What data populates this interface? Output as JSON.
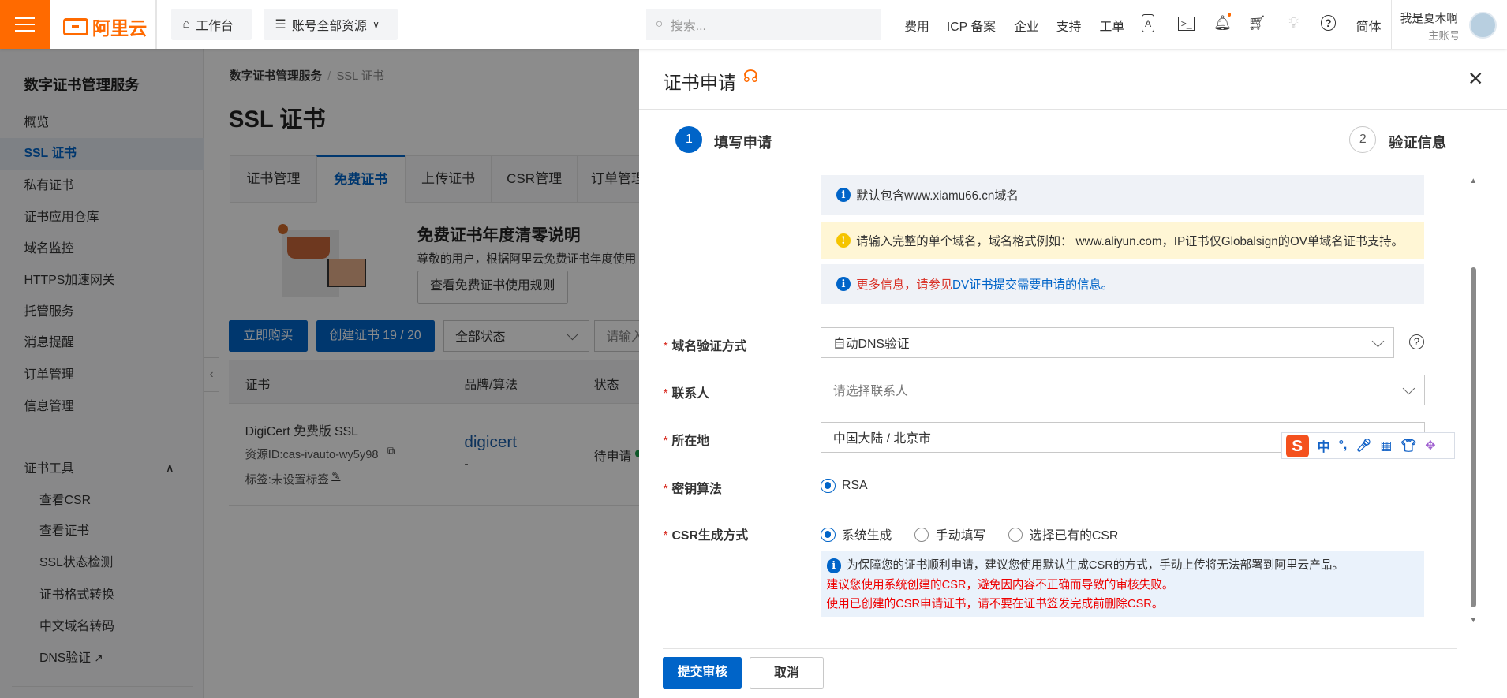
{
  "topbar": {
    "logo": "阿里云",
    "workbench": "工作台",
    "resources": "账号全部资源",
    "search_placeholder": "搜索...",
    "nav": [
      "费用",
      "ICP 备案",
      "企业",
      "支持",
      "工单"
    ],
    "icons": [
      "app-icon",
      "terminal-icon",
      "bell-icon",
      "cart-icon",
      "lightbulb-icon",
      "help-icon"
    ],
    "lang": "简体",
    "user_name": "我是夏木啊",
    "user_role": "主账号"
  },
  "sidebar": {
    "title": "数字证书管理服务",
    "items": [
      "概览",
      "SSL 证书",
      "私有证书",
      "证书应用仓库",
      "域名监控",
      "HTTPS加速网关",
      "托管服务",
      "消息提醒",
      "订单管理",
      "信息管理"
    ],
    "active": "SSL 证书",
    "tools_title": "证书工具",
    "tools": [
      "查看CSR",
      "查看证书",
      "SSL状态检测",
      "证书格式转换",
      "中文域名转码",
      "DNS验证"
    ]
  },
  "main": {
    "breadcrumb": [
      "数字证书管理服务",
      "SSL 证书"
    ],
    "title": "SSL 证书",
    "tabs": [
      "证书管理",
      "免费证书",
      "上传证书",
      "CSR管理",
      "订单管理"
    ],
    "active_tab": "免费证书",
    "banner": {
      "title": "免费证书年度清零说明",
      "text": "尊敬的用户，根据阿里云免费证书年度使用",
      "button": "查看免费证书使用规则"
    },
    "toolbar": {
      "buy": "立即购买",
      "create": "创建证书 19 / 20",
      "status_select": "全部状态",
      "input_placeholder": "请输入"
    },
    "table": {
      "headers": [
        "证书",
        "品牌/算法",
        "状态"
      ],
      "rows": [
        {
          "name": "DigiCert 免费版 SSL",
          "resource_id": "资源ID:cas-ivauto-wy5y98",
          "tag": "标签:未设置标签",
          "brand": "digicert",
          "algo": "-",
          "status": "待申请"
        }
      ]
    }
  },
  "drawer": {
    "title": "证书申请",
    "steps": [
      {
        "num": "1",
        "label": "填写申请"
      },
      {
        "num": "2",
        "label": "验证信息"
      }
    ],
    "alerts": [
      {
        "type": "info",
        "text": "默认包含www.xiamu66.cn域名"
      },
      {
        "type": "warning",
        "text": "请输入完整的单个域名，域名格式例如： www.aliyun.com，IP证书仅Globalsign的OV单域名证书支持。"
      },
      {
        "type": "info",
        "text_red": "更多信息，请参见",
        "link": "DV证书提交需要申请的信息。"
      }
    ],
    "form": {
      "verify_label": "域名验证方式",
      "verify_value": "自动DNS验证",
      "contact_label": "联系人",
      "contact_placeholder": "请选择联系人",
      "location_label": "所在地",
      "location_value": "中国大陆 / 北京市",
      "algo_label": "密钥算法",
      "algo_options": [
        "RSA"
      ],
      "csr_label": "CSR生成方式",
      "csr_options": [
        "系统生成",
        "手动填写",
        "选择已有的CSR"
      ],
      "csr_selected": "系统生成",
      "csr_note": "为保障您的证书顺利申请，建议您使用默认生成CSR的方式，手动上传将无法部署到阿里云产品。",
      "csr_warn1": "建议您使用系统创建的CSR，避免因内容不正确而导致的审核失败。",
      "csr_warn2": "使用已创建的CSR申请证书，请不要在证书签发完成前删除CSR。"
    },
    "submit": "提交审核",
    "cancel": "取消"
  },
  "ime": {
    "lang": "中",
    "punct": "°,"
  },
  "colors": {
    "brand": "#ff6a00",
    "primary": "#0064c8",
    "danger": "#d93026"
  }
}
